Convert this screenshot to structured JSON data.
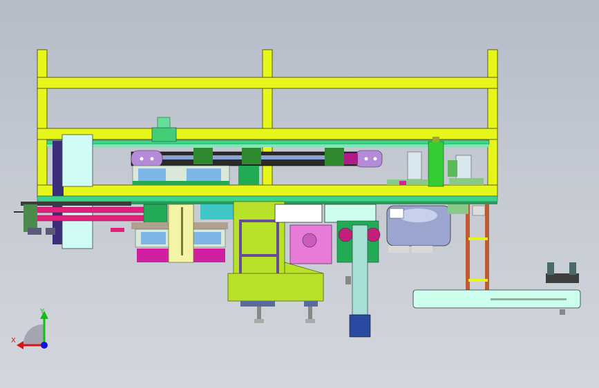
{
  "viewport": {
    "background_top": "#b5bcc8",
    "background_bottom": "#d3d6dc"
  },
  "model": {
    "frame_color": "#e6f51a",
    "frame_outline": "#5a6010"
  },
  "triad": {
    "x_label": "X",
    "y_label": "Y",
    "x_color": "#e01010",
    "y_color": "#10c010",
    "z_color": "#1010e0"
  }
}
